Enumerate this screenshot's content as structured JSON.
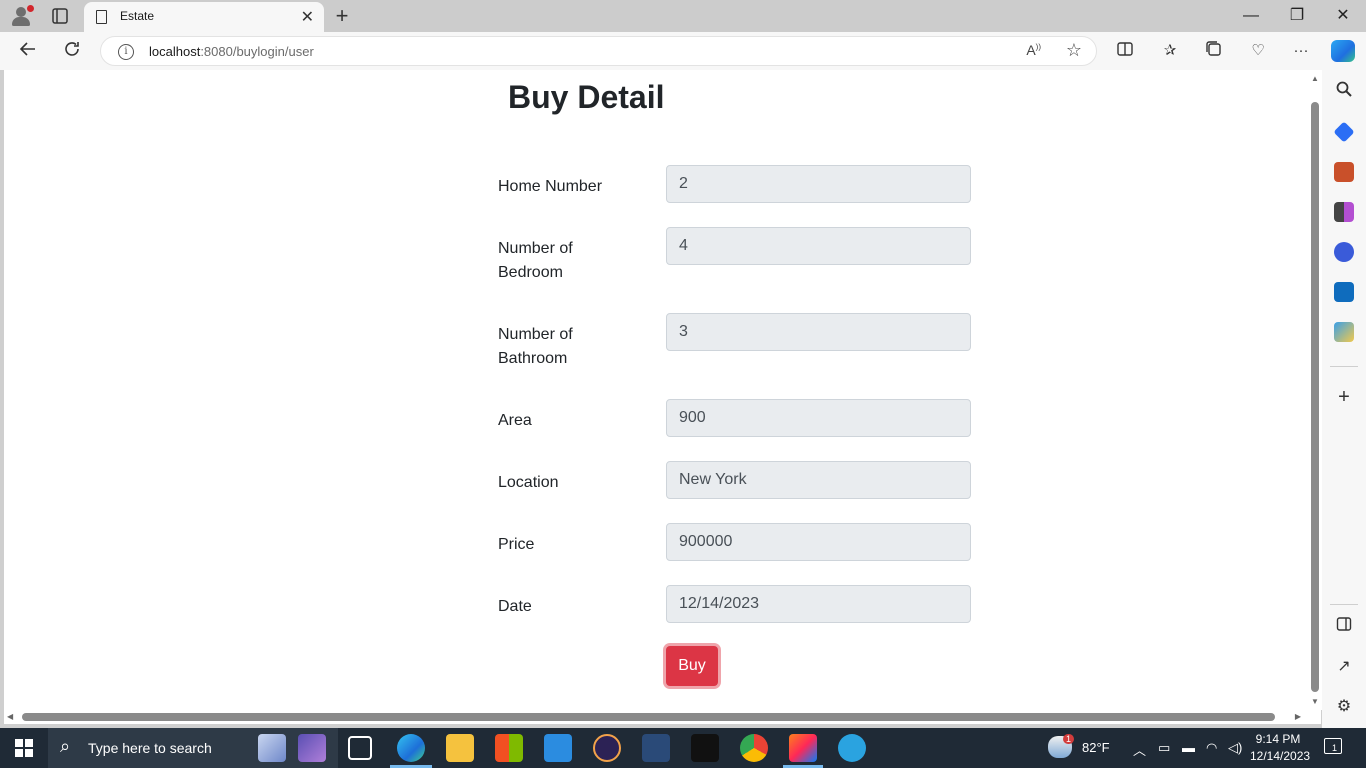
{
  "browser": {
    "tab_title": "Estate",
    "url_host": "localhost",
    "url_rest": ":8080/buylogin/user"
  },
  "page": {
    "title": "Buy Detail",
    "fields": [
      {
        "label": "Home Number",
        "value": "2"
      },
      {
        "label": "Number of Bedroom",
        "value": "4"
      },
      {
        "label": "Number of Bathroom",
        "value": "3"
      },
      {
        "label": "Area",
        "value": "900"
      },
      {
        "label": "Location",
        "value": "New York"
      },
      {
        "label": "Price",
        "value": "900000"
      },
      {
        "label": "Date",
        "value": "12/14/2023"
      }
    ],
    "buy_label": "Buy",
    "buy_color": "#dc3545"
  },
  "taskbar": {
    "search_placeholder": "Type here to search",
    "weather": "82°F",
    "weather_badge": "1",
    "time": "9:14 PM",
    "date": "12/14/2023",
    "notifications": "1"
  }
}
